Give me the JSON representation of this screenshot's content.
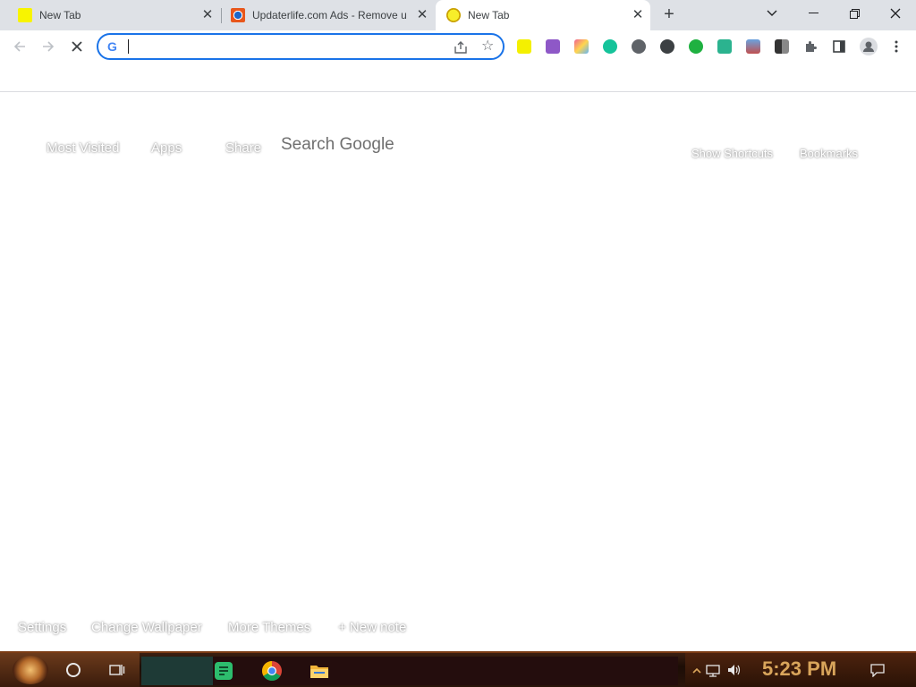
{
  "tabs": [
    {
      "title": "New Tab",
      "favicon": "yellow-square-icon",
      "active": false
    },
    {
      "title": "Updaterlife.com Ads - Remove u",
      "favicon": "pcrisk-icon",
      "active": false
    },
    {
      "title": "New Tab",
      "favicon": "yellow-circle-icon",
      "active": true
    }
  ],
  "omnibox": {
    "value": "",
    "placeholder": ""
  },
  "page": {
    "top_links": [
      "Most Visited",
      "Apps",
      "Share"
    ],
    "search_label": "Search Google",
    "right_links": [
      "Show Shortcuts",
      "Bookmarks"
    ],
    "bottom_links": [
      "Settings",
      "Change Wallpaper",
      "More Themes",
      "+ New note"
    ]
  },
  "taskbar": {
    "clock": "5:23 PM"
  },
  "colors": {
    "accent": "#1a73e8",
    "tabstrip": "#dee1e6",
    "clock": "#d9a55b"
  }
}
